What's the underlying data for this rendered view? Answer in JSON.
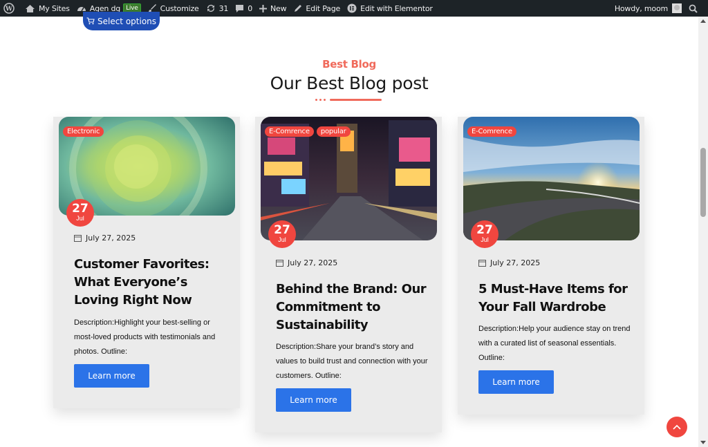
{
  "adminbar": {
    "my_sites": "My Sites",
    "site_name": "Agen dg",
    "live_badge": "Live",
    "customize": "Customize",
    "updates_count": "31",
    "comments_count": "0",
    "new": "New",
    "edit_page": "Edit Page",
    "edit_elementor": "Edit with Elementor",
    "howdy": "Howdy, moom"
  },
  "select_options_label": "Select options",
  "section": {
    "subtitle": "Best Blog",
    "title": "Our Best Blog post"
  },
  "posts": [
    {
      "tags": [
        "Electronic"
      ],
      "day": "27",
      "month": "Jul",
      "date": "July 27, 2025",
      "title": "Customer Favorites: What Everyone’s Loving Right Now",
      "description": "Description:Highlight your best-selling or most-loved products with testimonials and photos. Outline:",
      "button": "Learn more"
    },
    {
      "tags": [
        "E-Comrence",
        "popular"
      ],
      "day": "27",
      "month": "Jul",
      "date": "July 27, 2025",
      "title": "Behind the Brand: Our Commitment to Sustainability",
      "description": "Description:Share your brand’s story and values to build trust and connection with your customers. Outline:",
      "button": "Learn more"
    },
    {
      "tags": [
        "E-Comrence"
      ],
      "day": "27",
      "month": "Jul",
      "date": "July 27, 2025",
      "title": "5 Must-Have Items for Your Fall Wardrobe",
      "description": "Description:Help your audience stay on trend with a curated list of seasonal essentials. Outline:",
      "button": "Learn more"
    }
  ],
  "icons": {
    "wordpress": "wordpress-icon",
    "my_sites": "my-sites-icon",
    "dashboard": "dashboard-icon",
    "customize": "brush-icon",
    "updates": "updates-icon",
    "comments": "comment-icon",
    "new": "plus-icon",
    "edit": "pencil-icon",
    "elementor": "elementor-icon",
    "search": "search-icon",
    "cart": "cart-icon",
    "calendar": "calendar-icon",
    "back_to_top": "chevron-up-icon"
  },
  "colors": {
    "admin_bar": "#1d2327",
    "accent": "#f0463f",
    "button_blue": "#2b73e8",
    "select_blue": "#1f4eb5",
    "card_bg": "#ebebeb"
  }
}
